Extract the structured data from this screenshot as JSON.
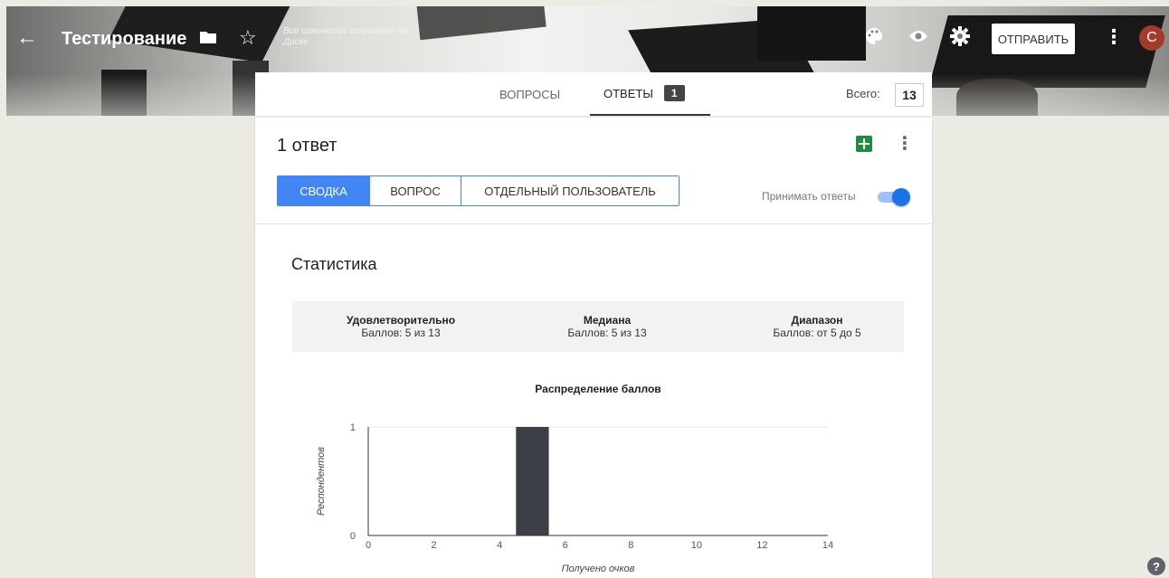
{
  "header": {
    "title": "Тестирование",
    "saved_status": "Все изменения сохранены на Диске",
    "send_label": "ОТПРАВИТЬ",
    "avatar_letter": "C"
  },
  "tabs": {
    "questions_label": "ВОПРОСЫ",
    "answers_label": "ОТВЕТЫ",
    "answers_count": "1",
    "total_label": "Всего:",
    "total_value": "13"
  },
  "responses": {
    "title": "1 ответ",
    "views": [
      "СВОДКА",
      "ВОПРОС",
      "ОТДЕЛЬНЫЙ ПОЛЬЗОВАТЕЛЬ"
    ],
    "accept_label": "Принимать ответы",
    "accepting": true
  },
  "stats": {
    "title": "Статистика",
    "items": [
      {
        "label": "Удовлетворительно",
        "value": "Баллов: 5 из 13"
      },
      {
        "label": "Медиана",
        "value": "Баллов: 5 из 13"
      },
      {
        "label": "Диапазон",
        "value": "Баллов: от 5 до 5"
      }
    ]
  },
  "chart_data": {
    "type": "bar",
    "title": "Распределение баллов",
    "xlabel": "Получено очков",
    "ylabel": "Респондентов",
    "x_ticks": [
      0,
      2,
      4,
      6,
      8,
      10,
      12,
      14
    ],
    "y_ticks": [
      0,
      1
    ],
    "xlim": [
      0,
      14
    ],
    "ylim": [
      0,
      1
    ],
    "bars": [
      {
        "x": 5,
        "value": 1
      }
    ],
    "bar_color": "#3c3f45"
  },
  "colors": {
    "accent": "#4285f4",
    "sheets_green": "#1e8e3e",
    "avatar": "#a33a2a"
  }
}
